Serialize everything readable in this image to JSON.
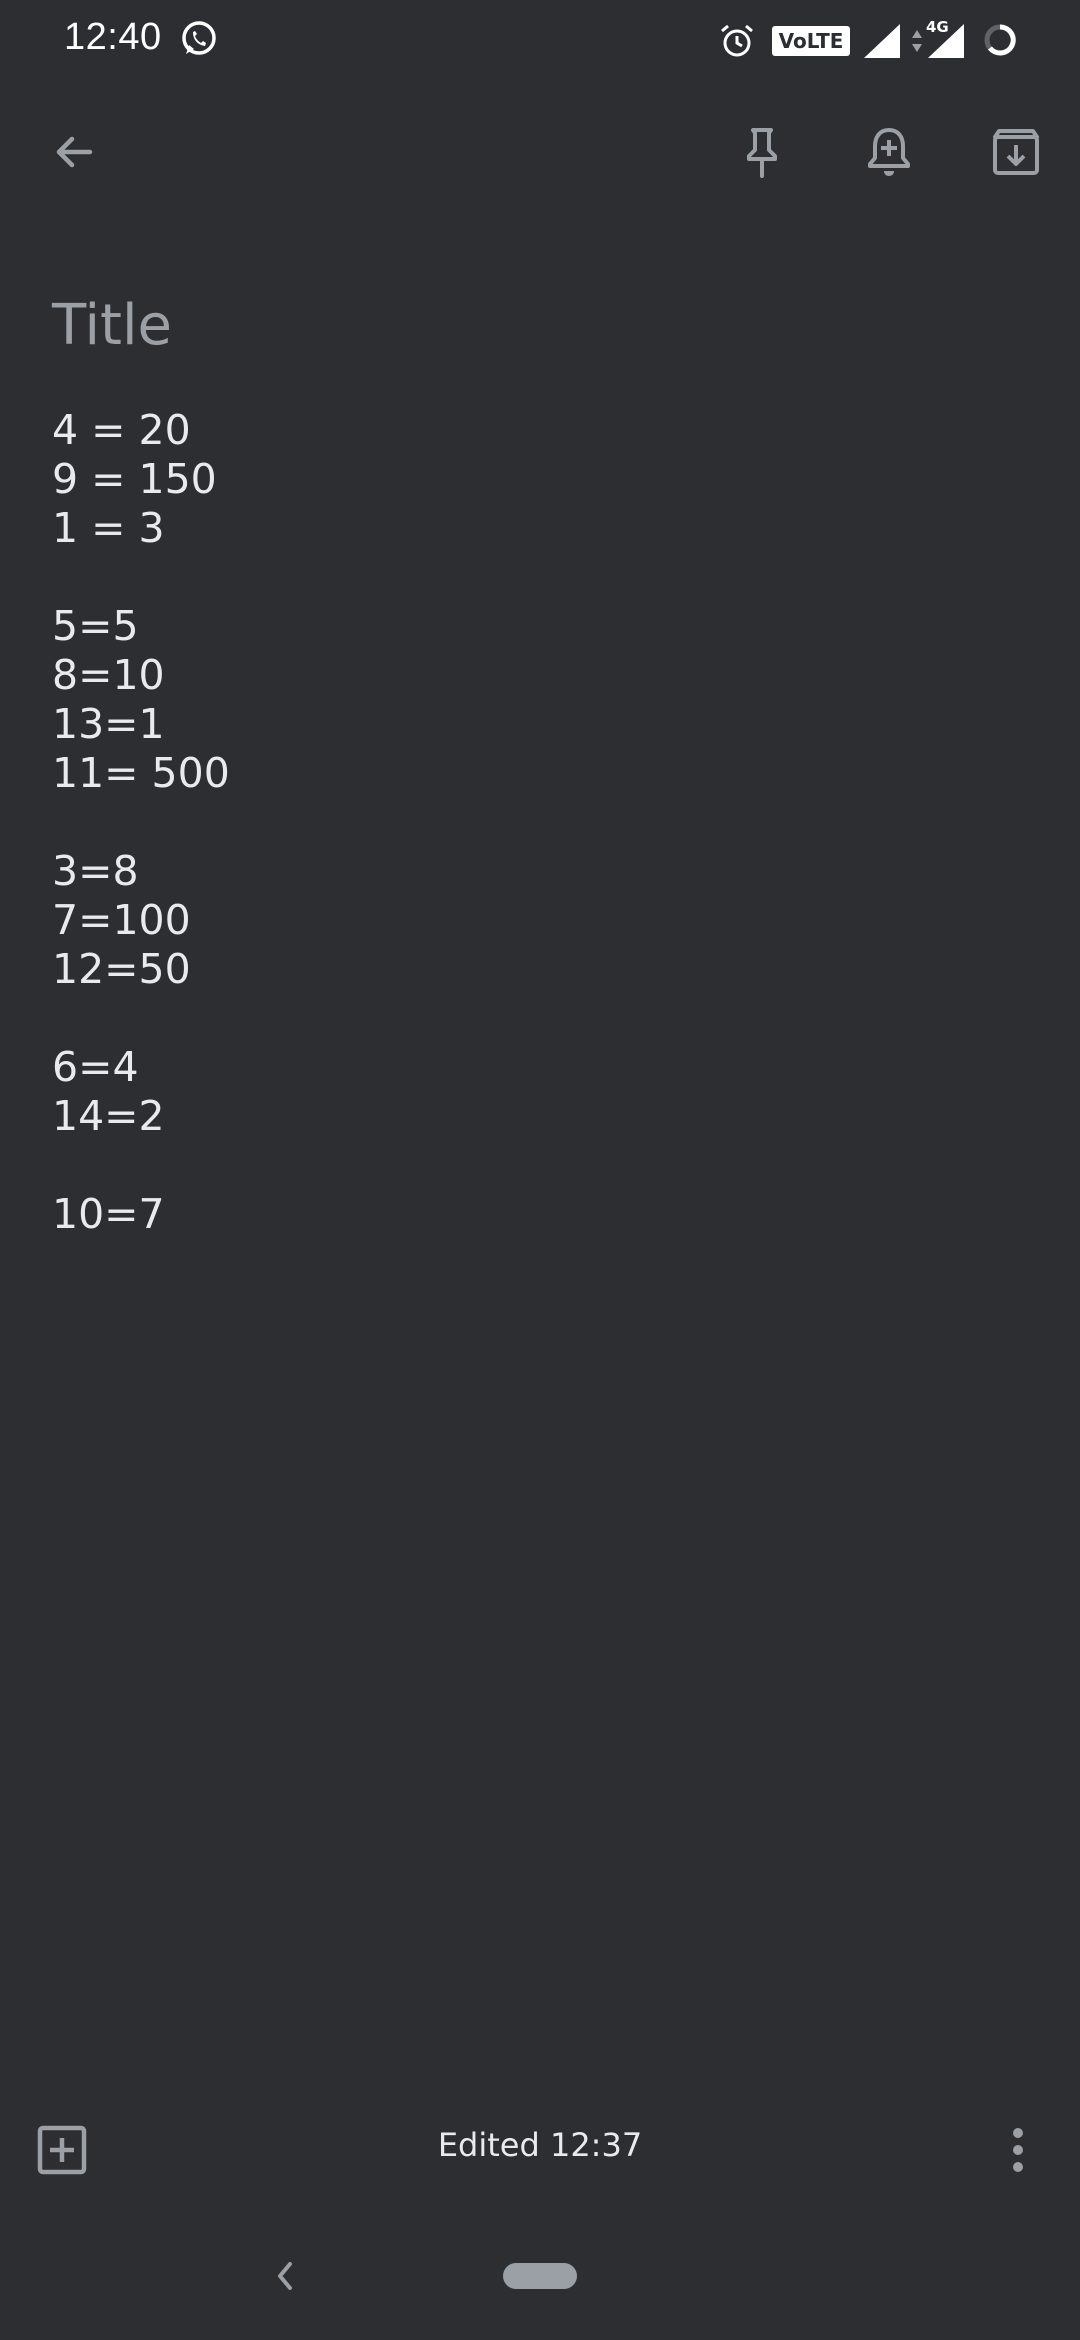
{
  "status_bar": {
    "time": "12:40",
    "volte_label": "VoLTE",
    "network_label": "4G",
    "icons": [
      "whatsapp-icon",
      "alarm-icon",
      "volte-icon",
      "signal-icon",
      "signal-4g-icon",
      "battery-icon"
    ]
  },
  "toolbar": {
    "icons": [
      "back-arrow-icon",
      "pin-icon",
      "reminder-bell-icon",
      "archive-icon"
    ]
  },
  "note": {
    "title_placeholder": "Title",
    "lines": [
      "4 = 20",
      "9 = 150",
      "1 = 3",
      "",
      "5=5",
      "8=10",
      "13=1",
      "11= 500",
      "",
      "3=8",
      "7=100",
      "12=50",
      "",
      "6=4",
      "14=2",
      "",
      "10=7"
    ]
  },
  "bottom_bar": {
    "edited_label": "Edited 12:37",
    "icons": [
      "add-box-icon",
      "more-vert-icon"
    ]
  },
  "colors": {
    "background": "#2d2e31",
    "text": "#e8eaed",
    "muted": "#9aa0a6"
  }
}
